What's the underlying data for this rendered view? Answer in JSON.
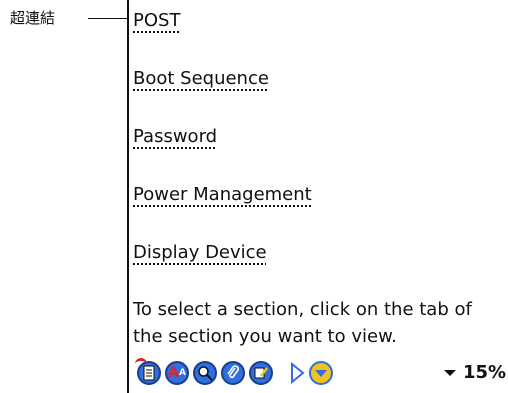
{
  "callout": {
    "label": "超連結"
  },
  "links": [
    {
      "label": "POST"
    },
    {
      "label": "Boot Sequence"
    },
    {
      "label": "Password"
    },
    {
      "label": "Power Management"
    },
    {
      "label": "Display Device"
    }
  ],
  "instruction": {
    "line1": "To select a section, click on the tab of",
    "line2": "the section you want to view."
  },
  "toolbar": {
    "icons": [
      "table-of-contents-icon",
      "font-size-icon",
      "find-icon",
      "attachment-icon",
      "note-edit-icon",
      "next-page-arrow-icon",
      "scroll-down-icon",
      "zoom-dropdown-icon"
    ],
    "zoom_label": "15%"
  },
  "colors": {
    "icon_blue": "#2f6fe0",
    "icon_red": "#d8262e",
    "icon_yellow": "#f3c21b",
    "text": "#111111"
  }
}
